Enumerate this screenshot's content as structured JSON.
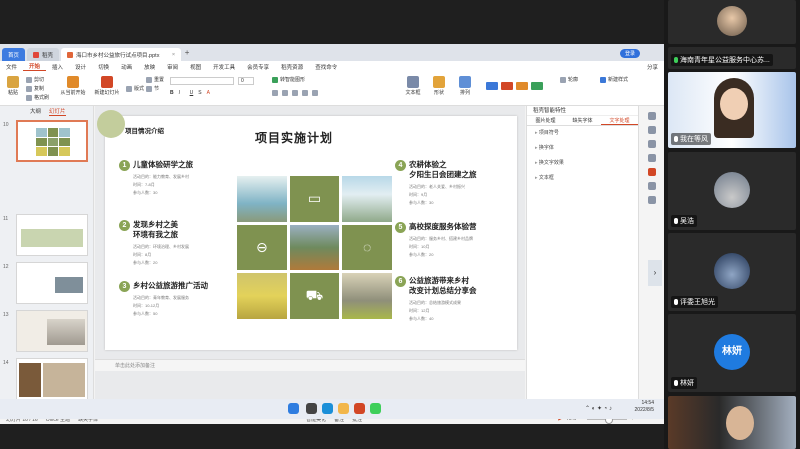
{
  "tabs": {
    "home": "首页",
    "wps": "稻壳",
    "active_file": "海口市乡村公益旅行试点项目.pptx",
    "login": "登录"
  },
  "menu": {
    "file": "文件",
    "start": "开始",
    "insert": "插入",
    "design": "设计",
    "transition": "切换",
    "animation": "动画",
    "slideshow": "放映",
    "review": "审阅",
    "view": "视图",
    "dev": "开发工具",
    "member": "会员专享",
    "resources": "稻壳资源",
    "search": "查找命令",
    "share": "分享"
  },
  "ribbon": {
    "cut": "剪切",
    "copy": "复制",
    "format_painter": "格式刷",
    "paste": "粘贴",
    "from_start": "从当前开始",
    "new_slide": "新建幻灯片",
    "layout": "版式",
    "section": "节",
    "reset": "重置",
    "textbox": "文本框",
    "shape": "形状",
    "arrange": "排列",
    "outline": "轮廓",
    "font_size": "0",
    "smart": "转智能图形",
    "font": "",
    "style_new": "新建样式"
  },
  "left": {
    "outline_tab": "大纲",
    "slides_tab": "幻灯片",
    "slide_numbers": [
      "10",
      "11",
      "12",
      "13",
      "14"
    ]
  },
  "slide": {
    "intro": "项目情况介绍",
    "title": "项目实施计划",
    "items": [
      {
        "n": "1",
        "title": "儿童体验研学之旅",
        "meta1": "活动目的：能力教育、发展乡村",
        "meta2": "时间：7-8月",
        "meta3": "参与人数：30"
      },
      {
        "n": "2",
        "title": "发现乡村之美\n环境有我之旅",
        "meta1": "活动目的：环境治理、乡村发展",
        "meta2": "时间：8月",
        "meta3": "参与人数：20"
      },
      {
        "n": "3",
        "title": "乡村公益旅游推广活动",
        "meta1": "活动目的：青年教育、发展服务",
        "meta2": "时间：10-12月",
        "meta3": "参与人数：50"
      },
      {
        "n": "4",
        "title": "农耕体验之\n夕阳生日会团建之旅",
        "meta1": "活动目的：老人关爱、乡村振兴",
        "meta2": "时间：9月",
        "meta3": "参与人数：30"
      },
      {
        "n": "5",
        "title": "高校探度服务体验营",
        "meta1": "活动目的：服务乡村、搭建乡村品牌",
        "meta2": "时间：10月",
        "meta3": "参与人数：20"
      },
      {
        "n": "6",
        "title": "公益旅游带来乡村\n改变计划总结分享会",
        "meta1": "活动目的：总结旅游模式成果",
        "meta2": "时间：12月",
        "meta3": "参与人数：40"
      }
    ],
    "icons": [
      "chat-icon",
      "zoom-out-icon",
      "chat-bubble-icon",
      "cart-icon"
    ]
  },
  "notes": "单击此处添加备注",
  "right_panel": {
    "title": "稻壳智能特性",
    "tabs": [
      "图片处理",
      "缺失字体",
      "文字处理"
    ],
    "rows": [
      "项目符号",
      "换字体",
      "换文字效果",
      "文本框"
    ]
  },
  "status": {
    "slide": "幻灯片 10 / 16",
    "theme": "Office 主题",
    "missing_font": "缺失字体",
    "smart_beautify": "智能美化",
    "notes": "备注",
    "comment": "批注",
    "zoom": "75%"
  },
  "taskbar": {
    "time": "14:54",
    "date": "2022/8/5"
  },
  "participants": [
    {
      "name": "",
      "muted": true
    },
    {
      "name": "海南青年星公益服务中心苏...",
      "muted": false
    },
    {
      "name": "我在等风",
      "muted": true
    },
    {
      "name": "吴浩",
      "muted": true
    },
    {
      "name": "评委王旭光",
      "muted": true
    },
    {
      "name": "林妍",
      "muted": true,
      "initials": "林妍"
    },
    {
      "name": "",
      "muted": true
    }
  ]
}
